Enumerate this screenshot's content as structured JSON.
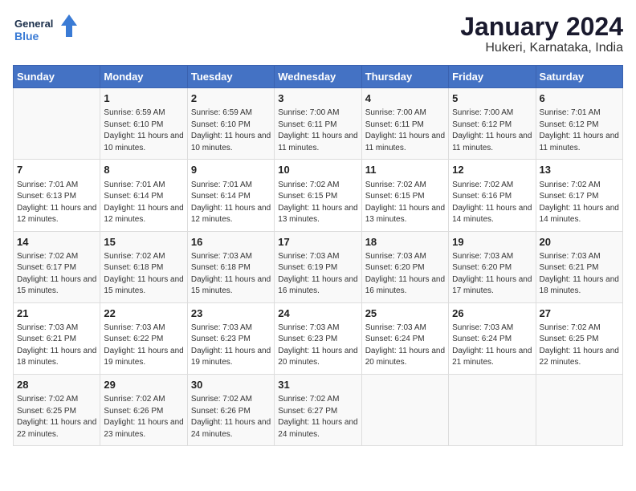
{
  "logo": {
    "text_general": "General",
    "text_blue": "Blue"
  },
  "header": {
    "title": "January 2024",
    "subtitle": "Hukeri, Karnataka, India"
  },
  "weekdays": [
    "Sunday",
    "Monday",
    "Tuesday",
    "Wednesday",
    "Thursday",
    "Friday",
    "Saturday"
  ],
  "weeks": [
    [
      {
        "day": "",
        "sunrise": "",
        "sunset": "",
        "daylight": ""
      },
      {
        "day": "1",
        "sunrise": "Sunrise: 6:59 AM",
        "sunset": "Sunset: 6:10 PM",
        "daylight": "Daylight: 11 hours and 10 minutes."
      },
      {
        "day": "2",
        "sunrise": "Sunrise: 6:59 AM",
        "sunset": "Sunset: 6:10 PM",
        "daylight": "Daylight: 11 hours and 10 minutes."
      },
      {
        "day": "3",
        "sunrise": "Sunrise: 7:00 AM",
        "sunset": "Sunset: 6:11 PM",
        "daylight": "Daylight: 11 hours and 11 minutes."
      },
      {
        "day": "4",
        "sunrise": "Sunrise: 7:00 AM",
        "sunset": "Sunset: 6:11 PM",
        "daylight": "Daylight: 11 hours and 11 minutes."
      },
      {
        "day": "5",
        "sunrise": "Sunrise: 7:00 AM",
        "sunset": "Sunset: 6:12 PM",
        "daylight": "Daylight: 11 hours and 11 minutes."
      },
      {
        "day": "6",
        "sunrise": "Sunrise: 7:01 AM",
        "sunset": "Sunset: 6:12 PM",
        "daylight": "Daylight: 11 hours and 11 minutes."
      }
    ],
    [
      {
        "day": "7",
        "sunrise": "Sunrise: 7:01 AM",
        "sunset": "Sunset: 6:13 PM",
        "daylight": "Daylight: 11 hours and 12 minutes."
      },
      {
        "day": "8",
        "sunrise": "Sunrise: 7:01 AM",
        "sunset": "Sunset: 6:14 PM",
        "daylight": "Daylight: 11 hours and 12 minutes."
      },
      {
        "day": "9",
        "sunrise": "Sunrise: 7:01 AM",
        "sunset": "Sunset: 6:14 PM",
        "daylight": "Daylight: 11 hours and 12 minutes."
      },
      {
        "day": "10",
        "sunrise": "Sunrise: 7:02 AM",
        "sunset": "Sunset: 6:15 PM",
        "daylight": "Daylight: 11 hours and 13 minutes."
      },
      {
        "day": "11",
        "sunrise": "Sunrise: 7:02 AM",
        "sunset": "Sunset: 6:15 PM",
        "daylight": "Daylight: 11 hours and 13 minutes."
      },
      {
        "day": "12",
        "sunrise": "Sunrise: 7:02 AM",
        "sunset": "Sunset: 6:16 PM",
        "daylight": "Daylight: 11 hours and 14 minutes."
      },
      {
        "day": "13",
        "sunrise": "Sunrise: 7:02 AM",
        "sunset": "Sunset: 6:17 PM",
        "daylight": "Daylight: 11 hours and 14 minutes."
      }
    ],
    [
      {
        "day": "14",
        "sunrise": "Sunrise: 7:02 AM",
        "sunset": "Sunset: 6:17 PM",
        "daylight": "Daylight: 11 hours and 15 minutes."
      },
      {
        "day": "15",
        "sunrise": "Sunrise: 7:02 AM",
        "sunset": "Sunset: 6:18 PM",
        "daylight": "Daylight: 11 hours and 15 minutes."
      },
      {
        "day": "16",
        "sunrise": "Sunrise: 7:03 AM",
        "sunset": "Sunset: 6:18 PM",
        "daylight": "Daylight: 11 hours and 15 minutes."
      },
      {
        "day": "17",
        "sunrise": "Sunrise: 7:03 AM",
        "sunset": "Sunset: 6:19 PM",
        "daylight": "Daylight: 11 hours and 16 minutes."
      },
      {
        "day": "18",
        "sunrise": "Sunrise: 7:03 AM",
        "sunset": "Sunset: 6:20 PM",
        "daylight": "Daylight: 11 hours and 16 minutes."
      },
      {
        "day": "19",
        "sunrise": "Sunrise: 7:03 AM",
        "sunset": "Sunset: 6:20 PM",
        "daylight": "Daylight: 11 hours and 17 minutes."
      },
      {
        "day": "20",
        "sunrise": "Sunrise: 7:03 AM",
        "sunset": "Sunset: 6:21 PM",
        "daylight": "Daylight: 11 hours and 18 minutes."
      }
    ],
    [
      {
        "day": "21",
        "sunrise": "Sunrise: 7:03 AM",
        "sunset": "Sunset: 6:21 PM",
        "daylight": "Daylight: 11 hours and 18 minutes."
      },
      {
        "day": "22",
        "sunrise": "Sunrise: 7:03 AM",
        "sunset": "Sunset: 6:22 PM",
        "daylight": "Daylight: 11 hours and 19 minutes."
      },
      {
        "day": "23",
        "sunrise": "Sunrise: 7:03 AM",
        "sunset": "Sunset: 6:23 PM",
        "daylight": "Daylight: 11 hours and 19 minutes."
      },
      {
        "day": "24",
        "sunrise": "Sunrise: 7:03 AM",
        "sunset": "Sunset: 6:23 PM",
        "daylight": "Daylight: 11 hours and 20 minutes."
      },
      {
        "day": "25",
        "sunrise": "Sunrise: 7:03 AM",
        "sunset": "Sunset: 6:24 PM",
        "daylight": "Daylight: 11 hours and 20 minutes."
      },
      {
        "day": "26",
        "sunrise": "Sunrise: 7:03 AM",
        "sunset": "Sunset: 6:24 PM",
        "daylight": "Daylight: 11 hours and 21 minutes."
      },
      {
        "day": "27",
        "sunrise": "Sunrise: 7:02 AM",
        "sunset": "Sunset: 6:25 PM",
        "daylight": "Daylight: 11 hours and 22 minutes."
      }
    ],
    [
      {
        "day": "28",
        "sunrise": "Sunrise: 7:02 AM",
        "sunset": "Sunset: 6:25 PM",
        "daylight": "Daylight: 11 hours and 22 minutes."
      },
      {
        "day": "29",
        "sunrise": "Sunrise: 7:02 AM",
        "sunset": "Sunset: 6:26 PM",
        "daylight": "Daylight: 11 hours and 23 minutes."
      },
      {
        "day": "30",
        "sunrise": "Sunrise: 7:02 AM",
        "sunset": "Sunset: 6:26 PM",
        "daylight": "Daylight: 11 hours and 24 minutes."
      },
      {
        "day": "31",
        "sunrise": "Sunrise: 7:02 AM",
        "sunset": "Sunset: 6:27 PM",
        "daylight": "Daylight: 11 hours and 24 minutes."
      },
      {
        "day": "",
        "sunrise": "",
        "sunset": "",
        "daylight": ""
      },
      {
        "day": "",
        "sunrise": "",
        "sunset": "",
        "daylight": ""
      },
      {
        "day": "",
        "sunrise": "",
        "sunset": "",
        "daylight": ""
      }
    ]
  ]
}
